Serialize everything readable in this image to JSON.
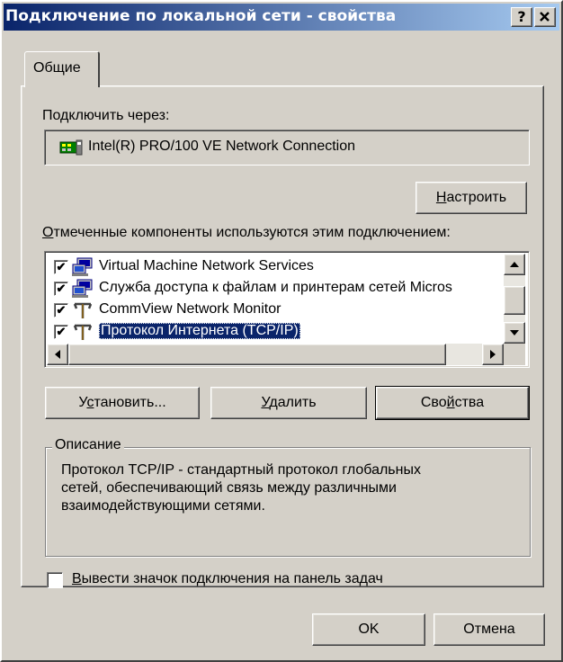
{
  "window": {
    "title": "Подключение по локальной сети - свойства",
    "help_label": "?",
    "close_label": "✕"
  },
  "tabs": [
    {
      "label": "Общие"
    }
  ],
  "connect": {
    "label": "Подключить через:",
    "adapter_name": "Intel(R) PRO/100 VE Network Connection",
    "configure_label": "Настроить",
    "configure_mnemonic": "Н",
    "configure_rest": "астроить"
  },
  "components": {
    "label_mnemonic": "О",
    "label_rest": "тмеченные компоненты используются этим подключением:",
    "items": [
      {
        "label": "Virtual Machine Network Services",
        "checked": true,
        "icon": "network-computers-icon",
        "selected": false
      },
      {
        "label": "Служба доступа к файлам и принтерам сетей Micros",
        "checked": true,
        "icon": "network-computers-icon",
        "selected": false
      },
      {
        "label": "CommView Network Monitor",
        "checked": true,
        "icon": "network-protocol-icon",
        "selected": false
      },
      {
        "label": "Протокол Интернета (TCP/IP)",
        "checked": true,
        "icon": "network-protocol-icon",
        "selected": true
      }
    ]
  },
  "buttons": {
    "install_pre": "У",
    "install_mnemonic": "с",
    "install_rest": "тановить...",
    "remove_mnemonic": "У",
    "remove_rest": "далить",
    "properties_pre": "Сво",
    "properties_mnemonic": "й",
    "properties_rest": "ства"
  },
  "description": {
    "legend": "Описание",
    "text_line1": "Протокол TCP/IP - стандартный протокол глобальных",
    "text_line2": "сетей, обеспечивающий связь между различными",
    "text_line3": "взаимодействующими сетями."
  },
  "taskbar_checkbox": {
    "mnemonic": "В",
    "rest": "ывести значок подключения на панель задач",
    "checked": false
  },
  "footer": {
    "ok_label": "OK",
    "cancel_label": "Отмена"
  },
  "colors": {
    "title_start": "#0a246a",
    "title_end": "#a6caf0",
    "face": "#d4d0c8",
    "selection": "#0a246a"
  }
}
